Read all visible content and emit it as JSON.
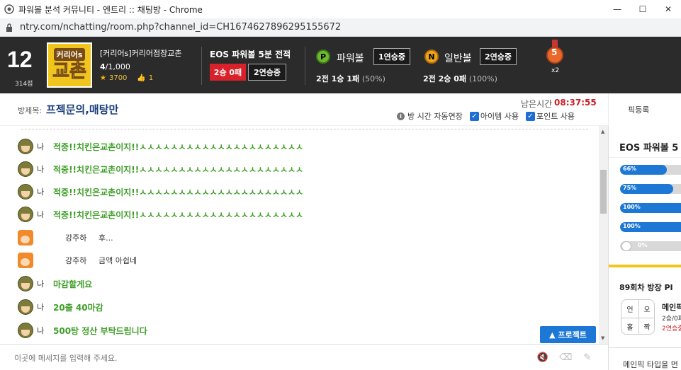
{
  "window": {
    "title": "파워볼 분석 커뮤니티 - 엔트리 :: 채팅방 - Chrome",
    "url": "ntry.com/nchatting/room.php?channel_id=CH1674627896295155672"
  },
  "header": {
    "level": "12",
    "points": "314점",
    "logo_top": "커리어s",
    "logo_main": "교촌",
    "room_owner": "[커리어s]커리어점장교촌",
    "members_current": "4",
    "members_total": "/1,000",
    "stars": "3700",
    "likes": "1",
    "eos_title": "EOS 파워볼 5분 전적",
    "eos_record": "2승 0패",
    "eos_streak": "2연승중",
    "powerball": {
      "coin": "P",
      "name": "파워볼",
      "streak": "1연승중",
      "record": "2전 1승 1패",
      "pct": "(50%)"
    },
    "normalball": {
      "coin": "N",
      "name": "일반볼",
      "streak": "2연승중",
      "record": "2전 2승 0패",
      "pct": "(100%)"
    },
    "medal_number": "5",
    "medal_multiplier": "x2"
  },
  "roombar": {
    "name_label": "방제목:",
    "name": "프젝문의,매탕만",
    "remain_label": "남은시간",
    "remain_time": "08:37:55",
    "option_extend": "방 시간 자동연장",
    "option_item": "아이템 사용",
    "option_point": "포인트 사용",
    "pick_register": "픽등록"
  },
  "chat": {
    "messages": [
      {
        "avatar": "army",
        "who": "나",
        "text": "적중!!치킨은교촌이지!!ㅅㅅㅅㅅㅅㅅㅅㅅㅅㅅㅅㅅㅅㅅㅅㅅㅅㅅㅅㅅㅅ"
      },
      {
        "avatar": "army",
        "who": "나",
        "text": "적중!!치킨은교촌이지!!ㅅㅅㅅㅅㅅㅅㅅㅅㅅㅅㅅㅅㅅㅅㅅㅅㅅㅅㅅㅅㅅ"
      },
      {
        "avatar": "army",
        "who": "나",
        "text": "적중!!치킨은교촌이지!!ㅅㅅㅅㅅㅅㅅㅅㅅㅅㅅㅅㅅㅅㅅㅅㅅㅅㅅㅅㅅㅅ"
      },
      {
        "avatar": "army",
        "who": "나",
        "text": "적중!!치킨은교촌이지!!ㅅㅅㅅㅅㅅㅅㅅㅅㅅㅅㅅㅅㅅㅅㅅㅅㅅㅅㅅㅅㅅ"
      },
      {
        "avatar": "new",
        "user": "강주하",
        "text": "후..."
      },
      {
        "avatar": "new",
        "user": "강주하",
        "text": "금액 아쉽네"
      },
      {
        "avatar": "army",
        "who": "나",
        "text": "마감할게요"
      },
      {
        "avatar": "army",
        "who": "나",
        "text": "20출 40마감"
      },
      {
        "avatar": "army",
        "who": "나",
        "text": "500탕 정산 부탁드립니다"
      }
    ],
    "project_button": "▲ 프로젝트",
    "input_placeholder": "이곳에 메세지를 입력해 주세요."
  },
  "right_panel": {
    "title": "EOS 파워볼 5",
    "bars": [
      {
        "label": "66%",
        "value": 0.66
      },
      {
        "label": "75%",
        "value": 0.75
      },
      {
        "label": "100%",
        "value": 1.0
      },
      {
        "label": "100%",
        "value": 1.0
      },
      {
        "label": "0%",
        "value": 0.0
      }
    ],
    "round_title": "89회차 방장 PI",
    "grid": [
      "언",
      "오",
      "홀",
      "짝"
    ],
    "main_pick": "메인픽",
    "main_record": "2승/0패",
    "main_streak": "2연승중",
    "bottom_text": "메인픽 타입을 먼"
  },
  "colors": {
    "accent_blue": "#1c78d4",
    "red": "#d8212a",
    "green_text": "#3e9e28",
    "header_bg": "#2b2b2b"
  }
}
